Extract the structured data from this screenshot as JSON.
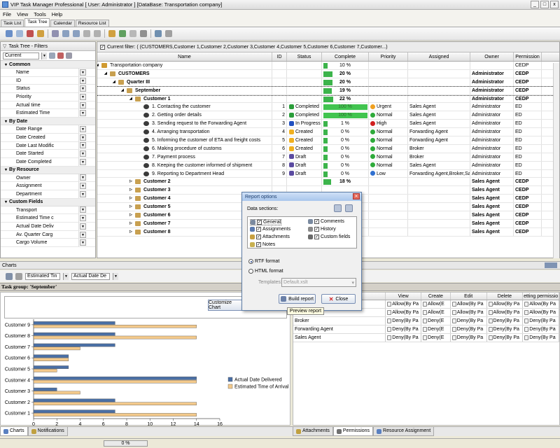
{
  "window": {
    "title": "VIP Task Manager Professional [ User: Administrator ] [DataBase: Transportation company]",
    "buttons": [
      "_",
      "□",
      "x"
    ]
  },
  "menu": [
    "File",
    "View",
    "Tools",
    "Help"
  ],
  "top_tabs": [
    "Task List",
    "Task Tree",
    "Calendar",
    "Resource List"
  ],
  "filters": {
    "header": "Task Tree - Filters",
    "current": "Current",
    "sections": [
      {
        "title": "Common",
        "items": [
          "Name",
          "ID",
          "Status",
          "Priority",
          "Actual time",
          "Estimated Time"
        ]
      },
      {
        "title": "By Date",
        "items": [
          "Date Range",
          "Date Created",
          "Date Last Modific",
          "Date Started",
          "Date Completed"
        ]
      },
      {
        "title": "By Resource",
        "items": [
          "Owner",
          "Assignment",
          "Department"
        ]
      },
      {
        "title": "Custom Fields",
        "items": [
          "Transport",
          "Estimated Time c",
          "Actual Date Deliv",
          "Av. Quarter Carg",
          "Cargo Volume"
        ]
      }
    ]
  },
  "grid": {
    "filter_text": "Current filter:  ( (CUSTOMERS,Customer 1,Customer 2,Customer 3,Customer 4,Customer 5,Customer 6,Customer 7,Customer...)",
    "columns": [
      "Name",
      "ID",
      "Status",
      "Complete",
      "Priority",
      "Assigned",
      "Owner",
      "Permission"
    ],
    "rows": [
      {
        "level": 0,
        "name": "Transportation company",
        "id": "",
        "status": "",
        "complete": 10,
        "complete_label": "10 %",
        "priority": "",
        "assigned": "",
        "owner": "",
        "perm": "CEDP",
        "bold": false,
        "icon": "home"
      },
      {
        "level": 1,
        "name": "CUSTOMERS",
        "id": "",
        "status": "",
        "complete": 20,
        "complete_label": "20 %",
        "priority": "",
        "assigned": "",
        "owner": "Administrator",
        "perm": "CEDP",
        "bold": true,
        "icon": "funnel"
      },
      {
        "level": 2,
        "name": "Quarter III",
        "id": "",
        "status": "",
        "complete": 20,
        "complete_label": "20 %",
        "priority": "",
        "assigned": "",
        "owner": "Administrator",
        "perm": "CEDP",
        "bold": true,
        "icon": "funnel"
      },
      {
        "level": 3,
        "name": "September",
        "id": "",
        "status": "",
        "complete": 19,
        "complete_label": "19 %",
        "priority": "",
        "assigned": "",
        "owner": "Administrator",
        "perm": "CEDP",
        "bold": true,
        "icon": "funnel"
      },
      {
        "level": 4,
        "name": "Customer 1",
        "id": "",
        "status": "",
        "complete": 22,
        "complete_label": "22 %",
        "priority": "",
        "assigned": "",
        "owner": "Administrator",
        "perm": "CEDP",
        "bold": true,
        "icon": "funnel"
      },
      {
        "level": 5,
        "name": "1. Contacting the customer",
        "id": "1",
        "status": "Completed",
        "complete": 100,
        "complete_label": "100 %",
        "priority": "Urgent",
        "assigned": "Sales Agent",
        "owner": "Administrator",
        "perm": "ED",
        "bold": false,
        "icon": "task"
      },
      {
        "level": 5,
        "name": "2. Getting order details",
        "id": "2",
        "status": "Completed",
        "complete": 100,
        "complete_label": "100 %",
        "priority": "Normal",
        "assigned": "Sales Agent",
        "owner": "Administrator",
        "perm": "ED",
        "bold": false,
        "icon": "task"
      },
      {
        "level": 5,
        "name": "3. Sending request to the Forwarding Agent",
        "id": "3",
        "status": "In Progress",
        "complete": 1,
        "complete_label": "1 %",
        "priority": "High",
        "assigned": "Sales Agent",
        "owner": "Administrator",
        "perm": "ED",
        "bold": false,
        "icon": "task"
      },
      {
        "level": 5,
        "name": "4. Arranging transportation",
        "id": "4",
        "status": "Created",
        "complete": 0,
        "complete_label": "0 %",
        "priority": "Normal",
        "assigned": "Forwarding Agent",
        "owner": "Administrator",
        "perm": "ED",
        "bold": false,
        "icon": "task"
      },
      {
        "level": 5,
        "name": "5. Informing the customer of ETA and freight costs",
        "id": "5",
        "status": "Created",
        "complete": 0,
        "complete_label": "0 %",
        "priority": "Normal",
        "assigned": "Forwarding Agent",
        "owner": "Administrator",
        "perm": "ED",
        "bold": false,
        "icon": "task"
      },
      {
        "level": 5,
        "name": "6. Making procedure of customs",
        "id": "6",
        "status": "Created",
        "complete": 0,
        "complete_label": "0 %",
        "priority": "Normal",
        "assigned": "Broker",
        "owner": "Administrator",
        "perm": "ED",
        "bold": false,
        "icon": "task"
      },
      {
        "level": 5,
        "name": "7. Payment process",
        "id": "7",
        "status": "Draft",
        "complete": 0,
        "complete_label": "0 %",
        "priority": "Normal",
        "assigned": "Broker",
        "owner": "Administrator",
        "perm": "ED",
        "bold": false,
        "icon": "task"
      },
      {
        "level": 5,
        "name": "8. Keeping the customer informed of shipment",
        "id": "8",
        "status": "Draft",
        "complete": 0,
        "complete_label": "0 %",
        "priority": "Normal",
        "assigned": "Sales Agent",
        "owner": "Administrator",
        "perm": "ED",
        "bold": false,
        "icon": "task"
      },
      {
        "level": 5,
        "name": "9. Reporting to Department Head",
        "id": "9",
        "status": "Draft",
        "complete": 0,
        "complete_label": "0 %",
        "priority": "Low",
        "assigned": "Forwarding Agent,Broker,Sal",
        "owner": "Administrator",
        "perm": "ED",
        "bold": false,
        "icon": "task"
      },
      {
        "level": 4,
        "name": "Customer 2",
        "id": "",
        "status": "",
        "complete": 18,
        "complete_label": "18 %",
        "priority": "",
        "assigned": "",
        "owner": "Sales Agent",
        "perm": "CEDP",
        "bold": true,
        "icon": "funnel"
      },
      {
        "level": 4,
        "name": "Customer 3",
        "id": "",
        "status": "",
        "complete": 0,
        "complete_label": "",
        "priority": "",
        "assigned": "",
        "owner": "Sales Agent",
        "perm": "CEDP",
        "bold": true,
        "icon": "funnel"
      },
      {
        "level": 4,
        "name": "Customer 4",
        "id": "",
        "status": "",
        "complete": 0,
        "complete_label": "",
        "priority": "",
        "assigned": "",
        "owner": "Sales Agent",
        "perm": "CEDP",
        "bold": true,
        "icon": "funnel"
      },
      {
        "level": 4,
        "name": "Customer 5",
        "id": "",
        "status": "",
        "complete": 0,
        "complete_label": "",
        "priority": "",
        "assigned": "",
        "owner": "Sales Agent",
        "perm": "CEDP",
        "bold": true,
        "icon": "funnel"
      },
      {
        "level": 4,
        "name": "Customer 6",
        "id": "",
        "status": "",
        "complete": 0,
        "complete_label": "",
        "priority": "",
        "assigned": "",
        "owner": "Sales Agent",
        "perm": "CEDP",
        "bold": true,
        "icon": "funnel"
      },
      {
        "level": 4,
        "name": "Customer 7",
        "id": "",
        "status": "",
        "complete": 0,
        "complete_label": "",
        "priority": "",
        "assigned": "",
        "owner": "Sales Agent",
        "perm": "CEDP",
        "bold": true,
        "icon": "funnel"
      },
      {
        "level": 4,
        "name": "Customer 8",
        "id": "",
        "status": "",
        "complete": 0,
        "complete_label": "",
        "priority": "",
        "assigned": "",
        "owner": "Sales Agent",
        "perm": "CEDP",
        "bold": true,
        "icon": "funnel"
      }
    ],
    "priority_colors": {
      "Urgent": "#f0a020",
      "Normal": "#2eaa3a",
      "High": "#d02020",
      "Low": "#3070d0"
    },
    "status_colors": {
      "Completed": "#2a9d3a",
      "In Progress": "#2050c0",
      "Created": "#f0b020",
      "Draft": "#5a4aa0"
    }
  },
  "charts_panel": {
    "title": "Charts",
    "dropdown1": "Estimated Tin",
    "dropdown2": "Actual Date De",
    "task_group": "Task group: 'September'",
    "customize_button": "Customize Chart"
  },
  "chart_data": {
    "type": "bar",
    "orientation": "horizontal",
    "categories": [
      "Customer 1",
      "Customer 2",
      "Customer 3",
      "Customer 4",
      "Customer 5",
      "Customer 6",
      "Customer 7",
      "Customer 8",
      "Customer 9"
    ],
    "series": [
      {
        "name": "Actual Date Delivered",
        "color": "#4a6fa5",
        "values": [
          7,
          7,
          2,
          14,
          3,
          3,
          7,
          7,
          7
        ]
      },
      {
        "name": "Estimated Time of Arrival",
        "color": "#f3c98b",
        "values": [
          14,
          14,
          4,
          14,
          2,
          3,
          4,
          14,
          14
        ]
      }
    ],
    "xlim": [
      0,
      16
    ],
    "xticks": [
      0,
      2,
      4,
      6,
      8,
      10,
      12,
      14,
      16
    ],
    "legend": "right"
  },
  "permissions": {
    "columns": [
      "",
      "View",
      "Create",
      "Edit",
      "Delete",
      "etting permissio"
    ],
    "rows": [
      {
        "name": "",
        "cells": [
          "Allow(By Pa",
          "Allow(E",
          "Allow(By Pa",
          "Allow(By Pa",
          "Allow(By Pa"
        ]
      },
      {
        "name": "",
        "cells": [
          "Allow(By Pa",
          "Allow(E",
          "Allow(By Pa",
          "Allow(By Pa",
          "Allow(By Pa"
        ]
      },
      {
        "name": "Broker",
        "cells": [
          "Deny(By Pa",
          "Deny(E",
          "Deny(By Pa",
          "Deny(By Pa",
          "Deny(By Pa"
        ]
      },
      {
        "name": "Forwarding Agent",
        "cells": [
          "Deny(By Pa",
          "Deny(E",
          "Deny(By Pa",
          "Deny(By Pa",
          "Deny(By Pa"
        ]
      },
      {
        "name": "Sales Agent",
        "cells": [
          "Deny(By Pa",
          "Deny(E",
          "Deny(By Pa",
          "Deny(By Pa",
          "Deny(By Pa"
        ]
      }
    ]
  },
  "bottom_tabs_left": [
    "Charts",
    "Notifications"
  ],
  "bottom_tabs_right": [
    "Attachments",
    "Permissions",
    "Resource Assignment"
  ],
  "status_progress": "0 %",
  "dialog": {
    "title": "Report options",
    "sections_label": "Data sections:",
    "sections": [
      {
        "label": "General",
        "checked": true,
        "color": "#7a8aa0"
      },
      {
        "label": "Comments",
        "checked": true,
        "color": "#7a8aa0"
      },
      {
        "label": "Assignments",
        "checked": true,
        "color": "#5a7ab0"
      },
      {
        "label": "History",
        "checked": true,
        "color": "#8a8a8a"
      },
      {
        "label": "Attachments",
        "checked": true,
        "color": "#c8a040"
      },
      {
        "label": "Custom fields",
        "checked": true,
        "color": "#6a6a6a"
      },
      {
        "label": "Notes",
        "checked": true,
        "color": "#c8b050"
      }
    ],
    "format_rtf": "RTF format",
    "format_html": "HTML format",
    "templates_label": "Templates:",
    "templates_value": "Default.xslt",
    "build_button": "Build report",
    "close_button": "Close",
    "tooltip": "Preview report"
  }
}
